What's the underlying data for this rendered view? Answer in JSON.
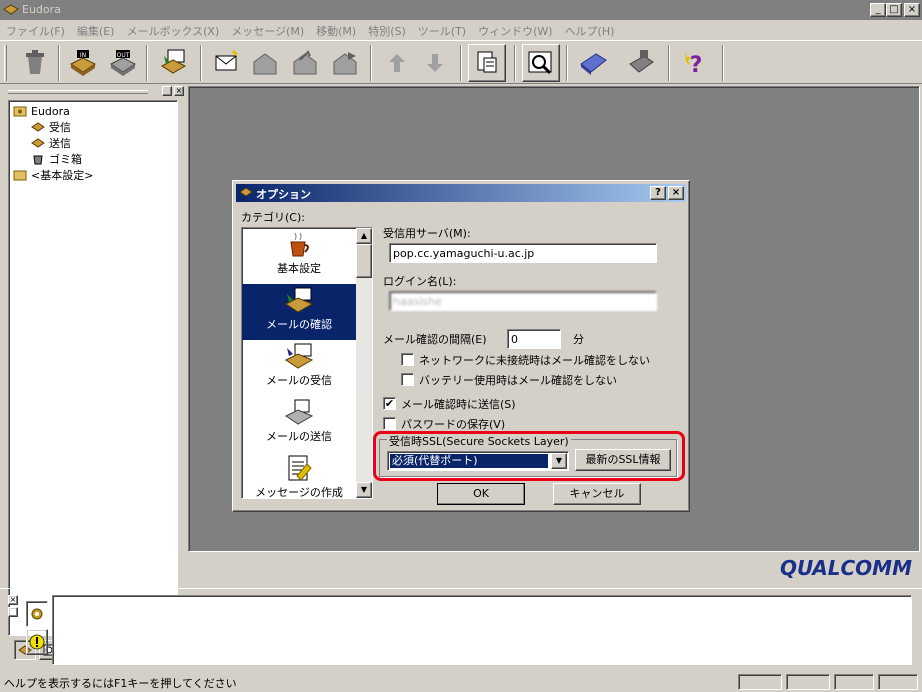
{
  "window": {
    "title": "Eudora",
    "minimize": "_",
    "maximize": "□",
    "close": "×"
  },
  "menu": [
    "ファイル(F)",
    "編集(E)",
    "メールボックス(X)",
    "メッセージ(M)",
    "移動(M)",
    "特別(S)",
    "ツール(T)",
    "ウィンドウ(W)",
    "ヘルプ(H)"
  ],
  "toolbar": {
    "in_label": "IN",
    "out_label": "OUT",
    "help_glyph": "?"
  },
  "tree": {
    "root": "Eudora",
    "inbox": "受信",
    "outbox": "送信",
    "trash": "ゴミ箱",
    "settings": "<基本設定>"
  },
  "dialog": {
    "title": "オプション",
    "help_btn": "?",
    "close_btn": "×",
    "category_label": "カテゴリ(C):",
    "categories": [
      "基本設定",
      "メールの確認",
      "メールの受信",
      "メールの送信",
      "メッセージの作成"
    ],
    "selected_category": "メールの確認",
    "server_label": "受信用サーバ(M):",
    "server_value": "pop.cc.yamaguchi-u.ac.jp",
    "login_label": "ログイン名(L):",
    "login_value": "haasishe",
    "interval_label": "メール確認の間隔(E)",
    "interval_value": "0",
    "interval_unit": "分",
    "opt_no_network": "ネットワークに未接続時はメール確認をしない",
    "opt_battery": "バッテリー使用時はメール確認をしない",
    "opt_send_on_check": "メール確認時に送信(S)",
    "opt_save_password": "パスワードの保存(V)",
    "check_mark": "✔",
    "ssl_group_label": "受信時SSL(Secure Sockets Layer)",
    "ssl_value": "必須(代替ポート)",
    "ssl_info_btn": "最新のSSL情報",
    "ok_btn": "OK",
    "cancel_btn": "キャンセル",
    "scroll_up": "▲",
    "scroll_down": "▼",
    "combo_arrow": "▼"
  },
  "brand": "QUALCOMM",
  "status": {
    "text": "ヘルプを表示するにはF1キーを押してください"
  },
  "colors": {
    "face": "#d4d0c8",
    "workspace": "#808080",
    "selection": "#0a246a",
    "highlight_ring": "#e8001a",
    "brand": "#1a2f8a"
  },
  "icons": [
    "app-icon",
    "checkmail-icon",
    "inbox-icon",
    "outbox-icon",
    "compose-icon",
    "reply-icon",
    "reply-all-icon",
    "forward-icon",
    "up-arrow-icon",
    "down-arrow-icon",
    "attach-icon",
    "find-icon",
    "address-book-icon",
    "print-icon",
    "help-icon",
    "folder-icon",
    "mailbox-icon",
    "trash-icon",
    "coffee-icon",
    "tray-icon"
  ]
}
